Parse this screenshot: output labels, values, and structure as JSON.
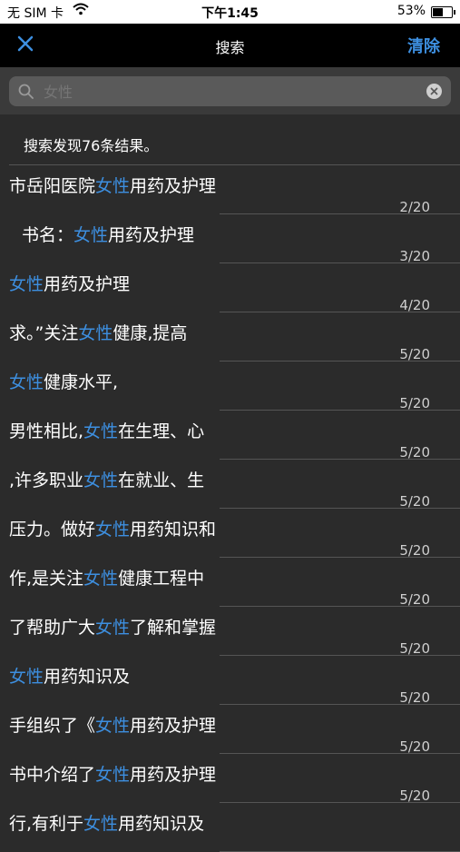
{
  "status": {
    "carrier": "无 SIM 卡",
    "time": "下午1:45",
    "battery": "53%",
    "battery_level": 0.53
  },
  "nav": {
    "title": "搜索",
    "clear_label": "清除"
  },
  "search": {
    "placeholder": "女性",
    "value": ""
  },
  "summary": "搜索发现76条结果。",
  "results": [
    {
      "before": "市岳阳医院",
      "hl": "女性",
      "after": "用药及护理",
      "page": "2/20"
    },
    {
      "before": "书名：",
      "hl": "女性",
      "after": "用药及护理",
      "page": "3/20"
    },
    {
      "before": "",
      "hl": "女性",
      "after": "用药及护理",
      "page": "4/20"
    },
    {
      "before": "求。”关注",
      "hl": "女性",
      "after": "健康,提高",
      "page": "5/20"
    },
    {
      "before": "",
      "hl": "女性",
      "after": "健康水平,",
      "page": "5/20"
    },
    {
      "before": "男性相比,",
      "hl": "女性",
      "after": "在生理、心",
      "page": "5/20"
    },
    {
      "before": ",许多职业",
      "hl": "女性",
      "after": "在就业、生",
      "page": "5/20"
    },
    {
      "before": "压力。做好",
      "hl": "女性",
      "after": "用药知识和",
      "page": "5/20"
    },
    {
      "before": "作,是关注",
      "hl": "女性",
      "after": "健康工程中",
      "page": "5/20"
    },
    {
      "before": "了帮助广大",
      "hl": "女性",
      "after": "了解和掌握",
      "page": "5/20"
    },
    {
      "before": "",
      "hl": "女性",
      "after": "用药知识及",
      "page": "5/20"
    },
    {
      "before": "手组织了《",
      "hl": "女性",
      "after": "用药及护理",
      "page": "5/20"
    },
    {
      "before": "书中介绍了",
      "hl": "女性",
      "after": "用药及护理",
      "page": "5/20"
    },
    {
      "before": "行,有利于",
      "hl": "女性",
      "after": "用药知识及",
      "page": ""
    }
  ],
  "colors": {
    "accent": "#3d8fe0",
    "background": "#2b2b2b"
  }
}
